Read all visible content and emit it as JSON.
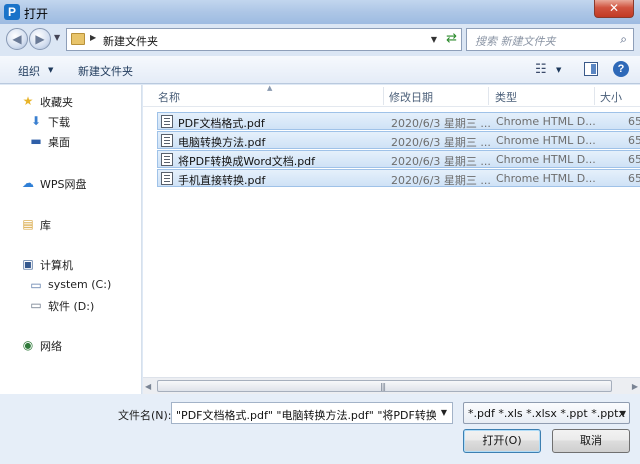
{
  "window": {
    "title": "打开",
    "app_icon_letter": "P"
  },
  "address": {
    "path": "新建文件夹",
    "search_placeholder": "搜索 新建文件夹"
  },
  "toolbar": {
    "organize": "组织",
    "new_folder": "新建文件夹"
  },
  "sidebar": {
    "favorites": "收藏夹",
    "downloads": "下载",
    "desktop": "桌面",
    "wps_cloud": "WPS网盘",
    "libraries": "库",
    "computer": "计算机",
    "drive_c": "system (C:)",
    "drive_d": "软件 (D:)",
    "network": "网络"
  },
  "columns": {
    "name": "名称",
    "modified": "修改日期",
    "type": "类型",
    "size": "大小"
  },
  "files": [
    {
      "name": "PDF文档格式.pdf",
      "modified": "2020/6/3 星期三 ...",
      "type": "Chrome HTML D...",
      "size": "65"
    },
    {
      "name": "电脑转换方法.pdf",
      "modified": "2020/6/3 星期三 ...",
      "type": "Chrome HTML D...",
      "size": "65"
    },
    {
      "name": "将PDF转换成Word文档.pdf",
      "modified": "2020/6/3 星期三 ...",
      "type": "Chrome HTML D...",
      "size": "65"
    },
    {
      "name": "手机直接转换.pdf",
      "modified": "2020/6/3 星期三 ...",
      "type": "Chrome HTML D...",
      "size": "65"
    }
  ],
  "bottom": {
    "filename_label": "文件名(N):",
    "filename_value": "\"PDF文档格式.pdf\" \"电脑转换方法.pdf\" \"将PDF转换成Word文档.pdf\" \"手机直接转换.pdf\"",
    "filetype_value": "*.pdf *.xls *.xlsx *.ppt *.pptx",
    "open_button": "打开(O)",
    "cancel_button": "取消"
  }
}
